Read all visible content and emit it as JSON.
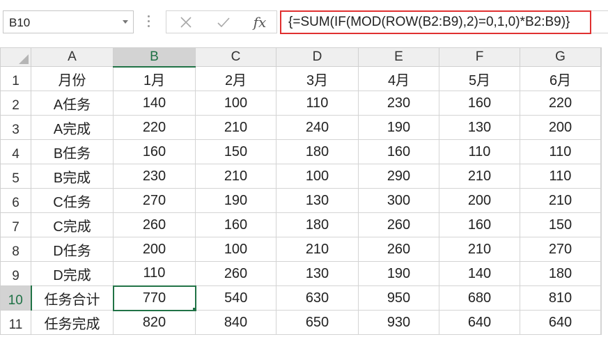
{
  "name_box": {
    "value": "B10"
  },
  "formula_bar": {
    "cancel_icon": "close-icon",
    "enter_icon": "check-icon",
    "fx_label": "fx",
    "formula": "{=SUM(IF(MOD(ROW(B2:B9),2)=0,1,0)*B2:B9)}"
  },
  "colors": {
    "highlight": "#e03030",
    "selection": "#217346"
  },
  "sheet": {
    "active_cell": "B10",
    "columns": [
      "A",
      "B",
      "C",
      "D",
      "E",
      "F",
      "G"
    ],
    "rows": [
      {
        "num": "1",
        "cells": [
          "月份",
          "1月",
          "2月",
          "3月",
          "4月",
          "5月",
          "6月"
        ]
      },
      {
        "num": "2",
        "cells": [
          "A任务",
          "140",
          "100",
          "110",
          "230",
          "160",
          "220"
        ]
      },
      {
        "num": "3",
        "cells": [
          "A完成",
          "220",
          "210",
          "240",
          "190",
          "130",
          "200"
        ]
      },
      {
        "num": "4",
        "cells": [
          "B任务",
          "160",
          "150",
          "180",
          "160",
          "110",
          "110"
        ]
      },
      {
        "num": "5",
        "cells": [
          "B完成",
          "230",
          "210",
          "100",
          "290",
          "210",
          "110"
        ]
      },
      {
        "num": "6",
        "cells": [
          "C任务",
          "270",
          "190",
          "130",
          "300",
          "200",
          "210"
        ]
      },
      {
        "num": "7",
        "cells": [
          "C完成",
          "260",
          "160",
          "180",
          "260",
          "160",
          "150"
        ]
      },
      {
        "num": "8",
        "cells": [
          "D任务",
          "200",
          "100",
          "210",
          "260",
          "210",
          "270"
        ]
      },
      {
        "num": "9",
        "cells": [
          "D完成",
          "110",
          "260",
          "130",
          "190",
          "140",
          "180"
        ]
      },
      {
        "num": "10",
        "cells": [
          "任务合计",
          "770",
          "540",
          "630",
          "950",
          "680",
          "810"
        ]
      },
      {
        "num": "11",
        "cells": [
          "任务完成",
          "820",
          "840",
          "650",
          "930",
          "640",
          "640"
        ]
      }
    ]
  }
}
